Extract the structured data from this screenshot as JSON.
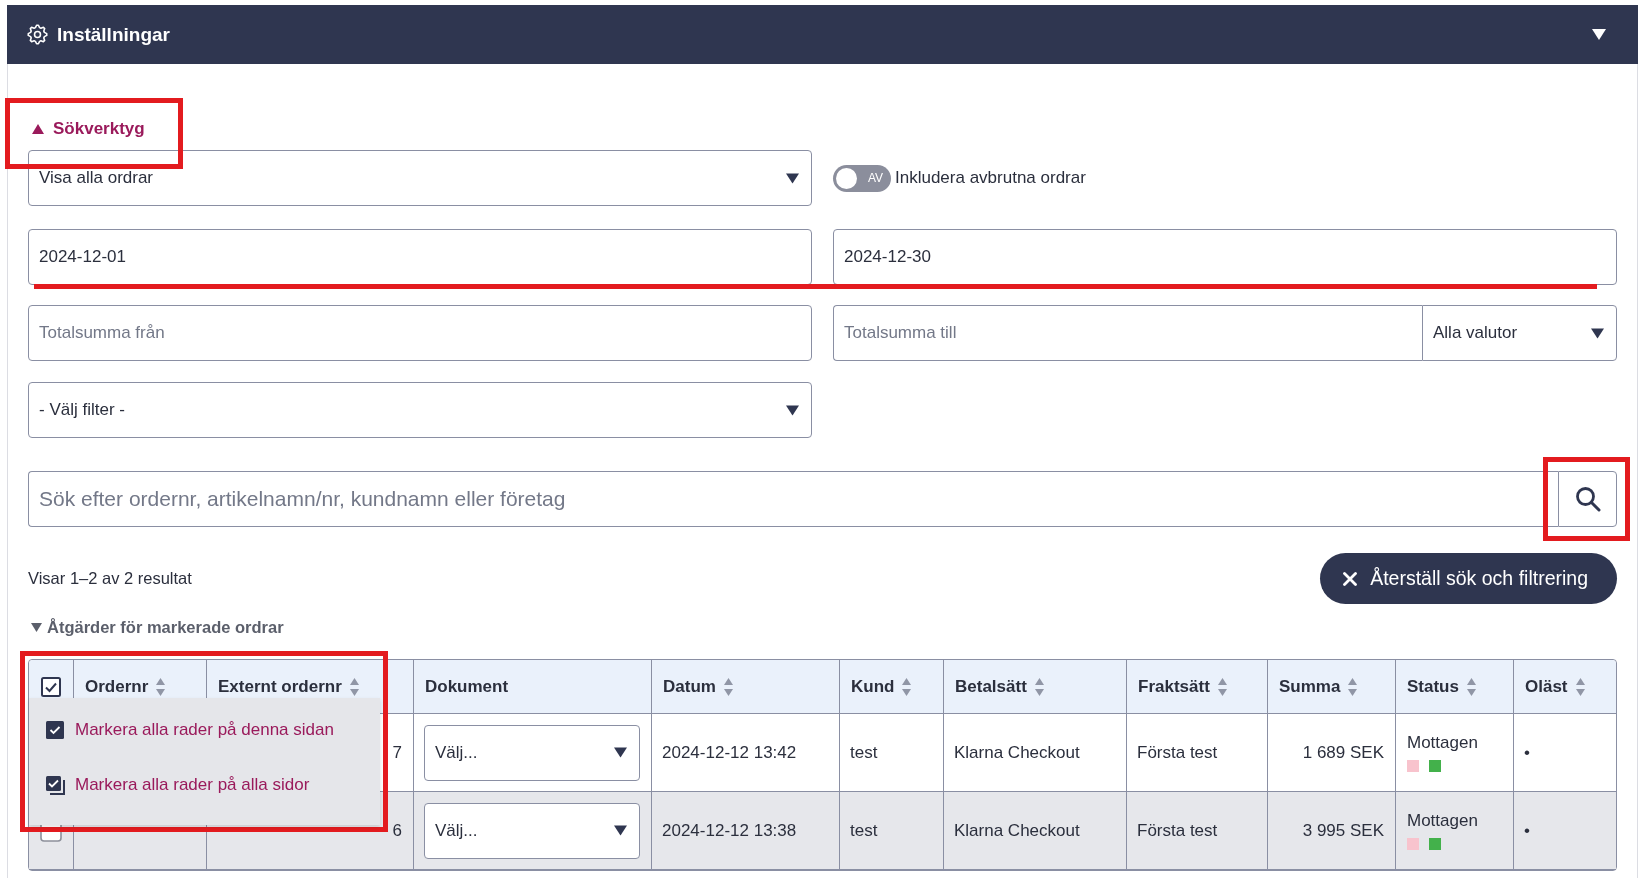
{
  "panel": {
    "title": "Inställningar"
  },
  "search_tools": {
    "label": "Sökverktyg",
    "expanded": true,
    "highlighted": true
  },
  "order_filter": {
    "value": "Visa alla ordrar"
  },
  "cancelled_toggle": {
    "on": false,
    "state_label": "AV",
    "label": "Inkludera avbrutna ordrar"
  },
  "date_range": {
    "from": "2024-12-01",
    "to": "2024-12-30",
    "underlined": true
  },
  "total_range": {
    "from_placeholder": "Totalsumma från",
    "to_placeholder": "Totalsumma till",
    "currency": "Alla valutor"
  },
  "filter": {
    "value": "- Välj filter -"
  },
  "search": {
    "placeholder": "Sök efter ordernr, artikelnamn/nr, kundnamn eller företag",
    "button_highlighted": true
  },
  "results_text": "Visar 1–2 av 2 resultat",
  "reset_button": {
    "label": "Återställ sök och filtrering"
  },
  "bulk_actions": {
    "label": "Åtgärder för markerade ordrar",
    "expanded": false
  },
  "table": {
    "columns": [
      {
        "kind": "checkbox",
        "checked": true
      },
      {
        "kind": "label",
        "label": "Ordernr",
        "sortable": true
      },
      {
        "kind": "label",
        "label": "Externt ordernr",
        "sortable": true
      },
      {
        "kind": "label",
        "label": "Dokument",
        "sortable": false
      },
      {
        "kind": "label",
        "label": "Datum",
        "sortable": true
      },
      {
        "kind": "label",
        "label": "Kund",
        "sortable": true
      },
      {
        "kind": "label",
        "label": "Betalsätt",
        "sortable": true
      },
      {
        "kind": "label",
        "label": "Fraktsätt",
        "sortable": true
      },
      {
        "kind": "label",
        "label": "Summa",
        "sortable": true
      },
      {
        "kind": "label",
        "label": "Status",
        "sortable": true
      },
      {
        "kind": "label",
        "label": "Oläst",
        "sortable": true
      }
    ],
    "select_menu": {
      "highlighted": true,
      "items": [
        {
          "kind": "single",
          "label": "Markera alla rader på denna sidan"
        },
        {
          "kind": "stacked",
          "label": "Markera alla rader på alla sidor"
        }
      ]
    },
    "rows": [
      {
        "external_ordernr": "7",
        "document": "Välj...",
        "date": "2024-12-12 13:42",
        "customer": "test",
        "payment": "Klarna Checkout",
        "shipping": "Första test",
        "sum": "1 689 SEK",
        "status": "Mottagen",
        "markers": [
          {
            "color": "#f8c3cd"
          },
          {
            "color": "#43b14b"
          }
        ],
        "unread": "•"
      },
      {
        "checked": false,
        "external_ordernr": "6",
        "document": "Välj...",
        "date": "2024-12-12 13:38",
        "customer": "test",
        "payment": "Klarna Checkout",
        "shipping": "Första test",
        "sum": "3 995 SEK",
        "status": "Mottagen",
        "markers": [
          {
            "color": "#f8c3cd"
          },
          {
            "color": "#43b14b"
          }
        ],
        "unread": "•"
      }
    ]
  }
}
